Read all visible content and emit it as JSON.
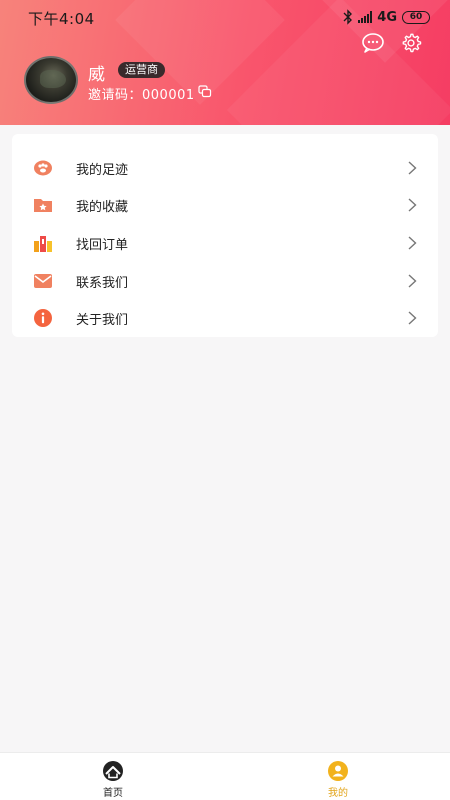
{
  "status_bar": {
    "time": "下午4:04",
    "network": "4G",
    "battery": "60"
  },
  "profile": {
    "name": "威",
    "role_badge": "运营商",
    "invite_code": "邀请码：000001"
  },
  "menu": {
    "items": [
      {
        "label": "我的足迹",
        "icon": "footprint-icon",
        "color": "#f08160"
      },
      {
        "label": "我的收藏",
        "icon": "favorite-folder-icon",
        "color": "#f08160"
      },
      {
        "label": "找回订单",
        "icon": "order-retrieve-icon",
        "color": "#f2a11b"
      },
      {
        "label": "联系我们",
        "icon": "mail-icon",
        "color": "#f08160"
      },
      {
        "label": "关于我们",
        "icon": "info-icon",
        "color": "#f4643f"
      }
    ]
  },
  "bottom_nav": {
    "home_label": "首页",
    "mine_label": "我的",
    "active": "mine",
    "active_color": "#e2a41a"
  },
  "colors": {
    "header_gradient_start": "#f7837b",
    "header_gradient_end": "#f53d63",
    "page_background": "#f7f6f7"
  }
}
